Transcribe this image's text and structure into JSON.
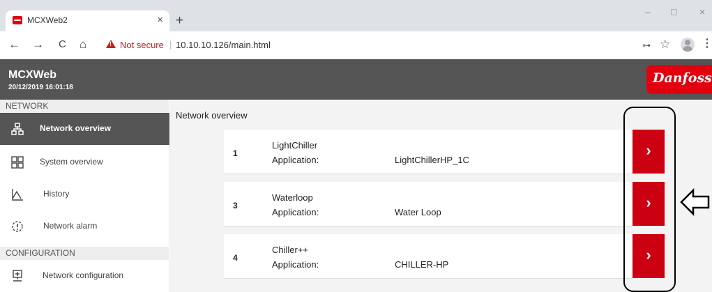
{
  "browser": {
    "tab_title": "MCXWeb2",
    "tab_close": "×",
    "new_tab": "+",
    "window_controls": {
      "minimize": "–",
      "maximize": "□",
      "close": "×"
    },
    "nav": {
      "back": "←",
      "forward": "→",
      "reload": "C",
      "home": "⌂"
    },
    "security_label": "Not secure",
    "url_separator": "|",
    "url": "10.10.10.126/main.html",
    "icons": {
      "key": "key-icon",
      "star": "star-icon",
      "profile": "profile-icon",
      "menu": "menu-icon"
    },
    "glyphs": {
      "key": "⊶",
      "star": "☆",
      "menu": "⋮"
    }
  },
  "header": {
    "title": "MCXWeb",
    "datetime": "20/12/2019 16:01:18",
    "brand": "Danfoss",
    "brand_color": "#e2000f"
  },
  "sidebar": {
    "sections": [
      {
        "label": "NETWORK",
        "items": [
          {
            "label": "Network overview",
            "icon": "network-icon",
            "active": true
          },
          {
            "label": "System overview",
            "icon": "grid-icon",
            "active": false
          },
          {
            "label": "History",
            "icon": "history-chart-icon",
            "active": false
          },
          {
            "label": "Network alarm",
            "icon": "alarm-icon",
            "active": false
          }
        ]
      },
      {
        "label": "CONFIGURATION",
        "items": [
          {
            "label": "Network configuration",
            "icon": "network-config-icon",
            "active": false
          }
        ]
      }
    ]
  },
  "main": {
    "title": "Network overview",
    "nodes": [
      {
        "number": "1",
        "name": "LightChiller",
        "app_label": "Application:",
        "app_value": "LightChillerHP_1C",
        "button": "›"
      },
      {
        "number": "3",
        "name": "Waterloop",
        "app_label": "Application:",
        "app_value": "Water Loop",
        "button": "›"
      },
      {
        "number": "4",
        "name": "Chiller++",
        "app_label": "Application:",
        "app_value": "CHILLER-HP",
        "button": "›"
      }
    ]
  },
  "colors": {
    "accent_red": "#cc0013",
    "header_gray": "#555555",
    "content_bg": "#f3f3f3",
    "warning_red": "#c5221f"
  }
}
